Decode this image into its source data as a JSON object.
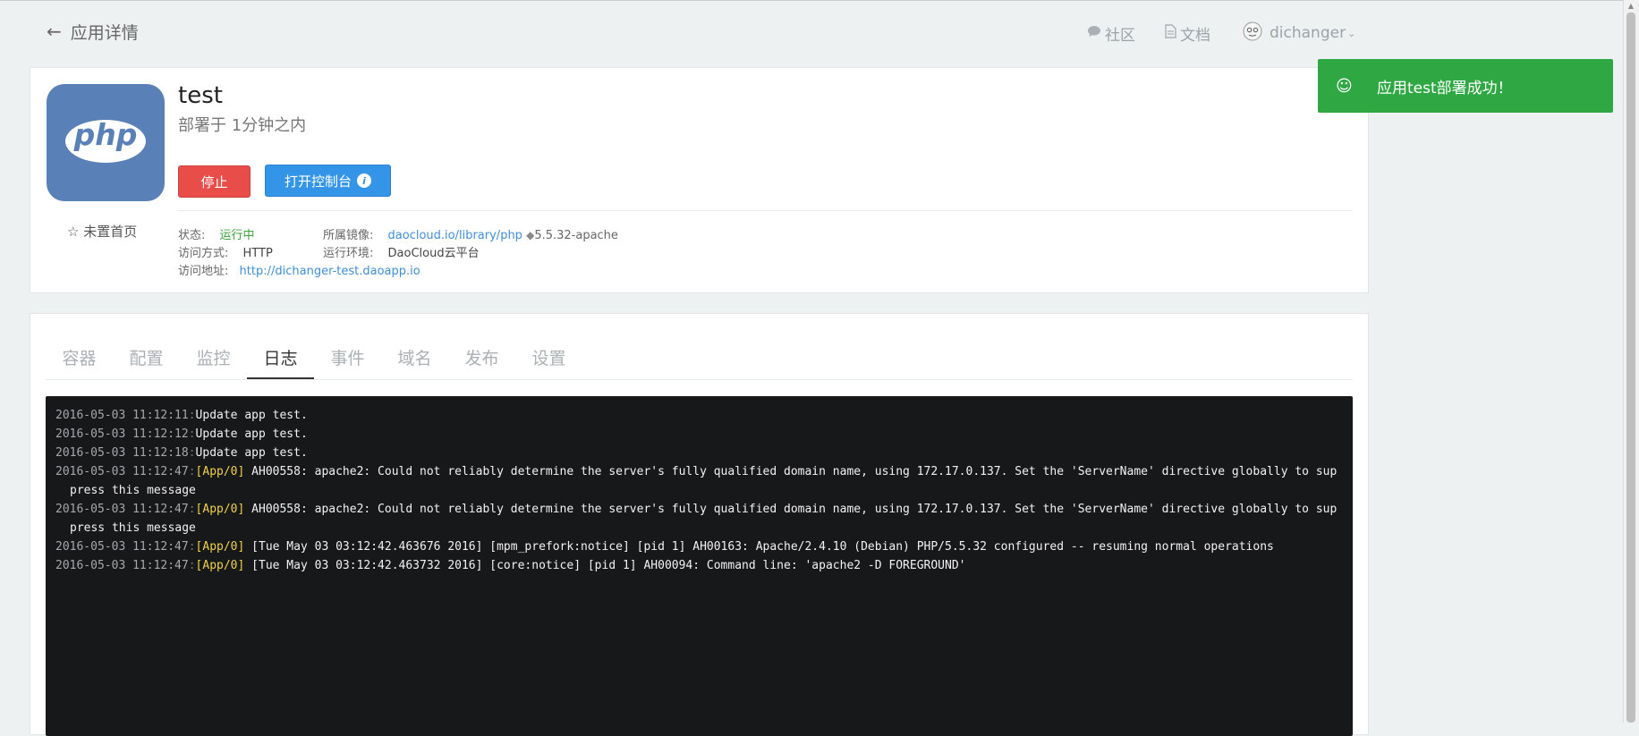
{
  "header": {
    "back_label": "应用详情",
    "nav": [
      {
        "label": "社区",
        "icon": "comment-icon"
      },
      {
        "label": "文档",
        "icon": "document-icon"
      },
      {
        "label": "dichanger",
        "icon": "avatar"
      }
    ]
  },
  "app": {
    "name": "test",
    "deployed_text": "部署于 1分钟之内",
    "logo_text": "php",
    "stop_label": "停止",
    "console_label": "打开控制台",
    "star_label": "未置首页",
    "status_label": "状态:",
    "status_value": "运行中",
    "image_label": "所属镜像:",
    "image_link": "daocloud.io/library/php",
    "image_tag": "5.5.32-apache",
    "access_label": "访问方式:",
    "access_value": "HTTP",
    "env_label": "运行环境:",
    "env_value": "DaoCloud云平台",
    "url_label": "访问地址:",
    "url_value": "http://dichanger-test.daoapp.io"
  },
  "tabs": [
    "容器",
    "配置",
    "监控",
    "日志",
    "事件",
    "域名",
    "发布",
    "设置"
  ],
  "active_tab": "日志",
  "logs": [
    {
      "ts": "2016-05-03 11:12:11",
      "src": "",
      "msg": "Update app test."
    },
    {
      "ts": "2016-05-03 11:12:12",
      "src": "",
      "msg": "Update app test."
    },
    {
      "ts": "2016-05-03 11:12:18",
      "src": "",
      "msg": "Update app test."
    },
    {
      "ts": "2016-05-03 11:12:47",
      "src": "[App/0]",
      "msg": "AH00558: apache2: Could not reliably determine the server's fully qualified domain name, using 172.17.0.137. Set the 'ServerName' directive globally to suppress this message"
    },
    {
      "ts": "2016-05-03 11:12:47",
      "src": "[App/0]",
      "msg": "AH00558: apache2: Could not reliably determine the server's fully qualified domain name, using 172.17.0.137. Set the 'ServerName' directive globally to suppress this message"
    },
    {
      "ts": "2016-05-03 11:12:47",
      "src": "[App/0]",
      "msg": "[Tue May 03 03:12:42.463676 2016] [mpm_prefork:notice] [pid 1] AH00163: Apache/2.4.10 (Debian) PHP/5.5.32 configured -- resuming normal operations"
    },
    {
      "ts": "2016-05-03 11:12:47",
      "src": "[App/0]",
      "msg": "[Tue May 03 03:12:42.463732 2016] [core:notice] [pid 1] AH00094: Command line: 'apache2 -D FOREGROUND'"
    }
  ],
  "toast": {
    "message": "应用test部署成功！"
  },
  "colors": {
    "stop": "#e84d49",
    "console": "#3394e8",
    "toast": "#2fa844",
    "running": "#3aa33a",
    "logo_bg": "#5a80b8"
  }
}
